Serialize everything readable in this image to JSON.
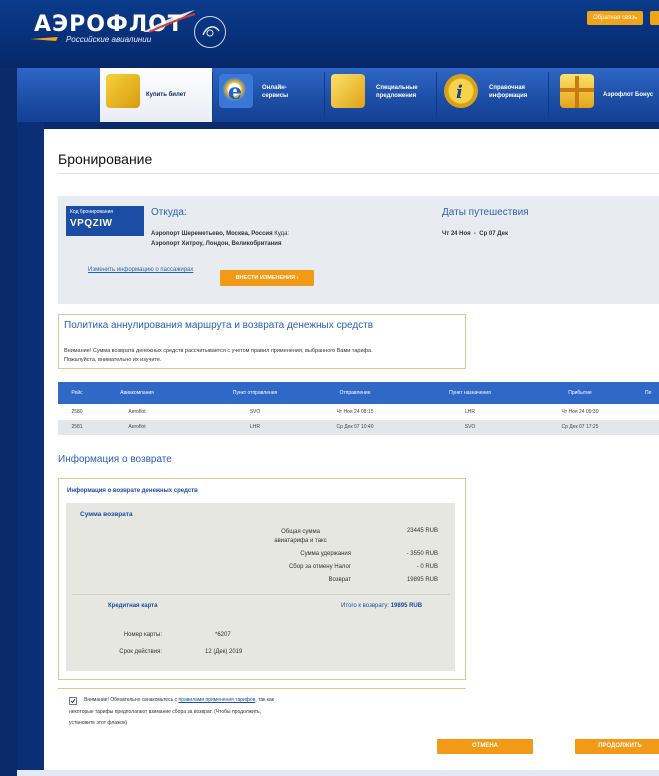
{
  "header": {
    "logo_text": "АЭРОФЛОТ",
    "logo_subtitle": "Российские авиалинии",
    "feedback_label": "Обратная связь"
  },
  "nav": {
    "items": [
      {
        "label": "Купить билет",
        "icon": "tickets-icon"
      },
      {
        "label": "Онлайн-\nсервисы",
        "icon": "internet-explorer-icon"
      },
      {
        "label": "Специальные\nпредложения",
        "icon": "special-offers-icon"
      },
      {
        "label": "Справочная\nинформация",
        "icon": "info-icon"
      },
      {
        "label": "Аэрофлот Бонус",
        "icon": "gift-icon"
      }
    ]
  },
  "page": {
    "title": "Бронирование"
  },
  "booking": {
    "code_label": "Код бронирования",
    "code": "VPQZIW",
    "from_heading": "Откуда:",
    "from_airport": "Аэропорт Шереметьево, Москва, Россия",
    "to_label": "Куда:",
    "to_airport": "Аэропорт Хитроу, Лондон, Великобритания",
    "dates_heading": "Даты путешествия",
    "dates": "Чт 24 Ноя  -  Ср 07 Дек",
    "change_passengers_link": "Изменить информацию о пассажирах",
    "apply_changes_button": "ВНЕСТИ ИЗМЕНЕНИЯ"
  },
  "policy": {
    "heading": "Политика аннулирования маршрута и возврата денежных средств",
    "text1": "Внимание! Сумма возврата денежных средств рассчитывается с учетом правил применения, выбранного Вами тарифа.",
    "text2": "Пожалуйста, внимательно их изучите."
  },
  "flights": {
    "headers": [
      "Рейс",
      "Авиакомпания",
      "Пункт отправления",
      "Отправление",
      "Пункт назначения",
      "Прибытие",
      "Пе"
    ],
    "rows": [
      [
        "2580",
        "Aeroflot",
        "SVO",
        "Чт Ноя 24 08:15",
        "LHR",
        "Чт Ноя 24 09:30"
      ],
      [
        "2581",
        "Aeroflot",
        "LHR",
        "Ср Дек 07 10:40",
        "SVO",
        "Ср Дек 07 17:25"
      ]
    ]
  },
  "refund": {
    "heading": "Информация о возврате",
    "subheading": "Информация о возврате денежных средств",
    "sum_heading": "Сумма возврата",
    "lines": [
      {
        "label": "Общая сумма\nавиатарифа и такс",
        "value": "23445 RUB"
      },
      {
        "label": "Сумма удержания",
        "value": "- 3550 RUB"
      },
      {
        "label": "Сбор за отмену Налог",
        "value": "- 0 RUB"
      },
      {
        "label": "Возврат",
        "value": "19895 RUB"
      }
    ],
    "card_heading": "Кредитная карта",
    "total_label": "Итого к возврату:",
    "total_value": "19895 RUB",
    "card_number_label": "Номер карты:",
    "card_number": "*6207",
    "expiry_label": "Срок действия:",
    "expiry": "12 (Дек) 2019"
  },
  "agreement": {
    "text_before": "Внимание! Обязательно ознакомьтесь с",
    "link": "правилами применения тарифов",
    "text_after1": ", так как",
    "line2": "некоторые тарифы предполагают взимание сбора за возврат. (Чтобы продолжить,",
    "line3": "установите этот флажок)"
  },
  "buttons": {
    "cancel": "ОТМЕНА",
    "continue": "ПРОДОЛЖИТЬ"
  },
  "colors": {
    "brand_blue": "#1a4da3",
    "accent_orange": "#f29a16",
    "header_navy": "#06286a"
  }
}
